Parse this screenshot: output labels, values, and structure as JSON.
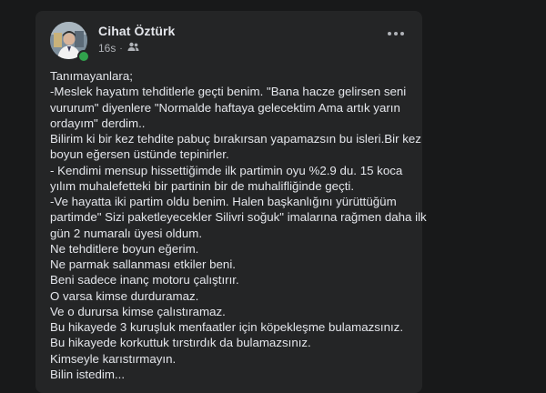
{
  "post": {
    "author_name": "Cihat Öztürk",
    "timestamp": "16s",
    "separator": "·",
    "audience_icon": "friends-icon",
    "more_icon": "more-options-icon",
    "avatar_online_color": "#31a24c",
    "lines": [
      "Tanımayanlara;",
      "-Meslek hayatım tehditlerle geçti benim. \"Bana hacze gelirsen seni",
      "vururum\" diyenlere \"Normalde haftaya gelecektim Ama artık yarın",
      "ordayım\" derdim..",
      "Bilirim ki bir kez tehdite pabuç bırakırsan yapamazsın bu isleri.Bir kez",
      "boyun eğersen üstünde tepinirler.",
      "- Kendimi mensup hissettiğimde ilk partimin oyu %2.9 du. 15 koca",
      "yılım muhalefetteki bir partinin bir de muhalifliğinde geçti.",
      "-Ve hayatta iki partim oldu benim. Halen başkanlığını yürüttüğüm",
      "partimde\" Sizi paketleyecekler Silivri soğuk\" imalarına rağmen daha ilk",
      "gün 2 numaralı üyesi oldum.",
      "Ne tehditlere boyun eğerim.",
      "Ne parmak sallanması etkiler beni.",
      "Beni sadece inanç motoru çalıştırır.",
      "O varsa kimse durduramaz.",
      "Ve o durursa kimse çalıstıramaz.",
      "Bu hikayede 3 kuruşluk menfaatler için köpekleşme bulamazsınız.",
      "Bu hikayede korkuttuk tırstırdık da bulamazsınız.",
      "Kimseyle karıstırmayın.",
      "Bilin istedim..."
    ]
  }
}
